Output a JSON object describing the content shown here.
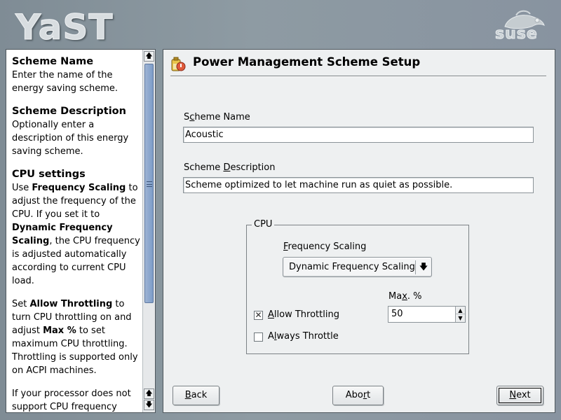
{
  "header": {
    "app_logo_text": "YaST",
    "brand_logo_text": "suse"
  },
  "help": {
    "sections": [
      {
        "heading": "Scheme Name",
        "body": "Enter the name of the energy saving scheme."
      },
      {
        "heading": "Scheme Description",
        "body": "Optionally enter a description of this energy saving scheme."
      },
      {
        "heading": "CPU settings"
      }
    ],
    "cpu_p1": {
      "t1": "Use ",
      "b1": "Frequency Scaling",
      "t2": " to adjust the frequency of the CPU. If you set it to ",
      "b2": "Dynamic Frequency Scaling",
      "t3": ", the CPU frequency is adjusted automatically according to current CPU load."
    },
    "cpu_p2": {
      "t1": "Set ",
      "b1": "Allow Throttling",
      "t2": " to turn CPU throttling on and adjust ",
      "b2": "Max %",
      "t3": " to set maximum CPU throttling. Throttling is supported only on ACPI machines."
    },
    "cpu_p3": "If your processor does not support CPU frequency scaling you may want to let"
  },
  "main": {
    "title": "Power Management Scheme Setup",
    "scheme_name_label": {
      "pre": "S",
      "u": "c",
      "post": "heme Name"
    },
    "scheme_name_value": "Acoustic",
    "scheme_desc_label": {
      "pre": "Scheme ",
      "u": "D",
      "post": "escription"
    },
    "scheme_desc_value": "Scheme optimized to let machine run as quiet as possible.",
    "cpu_group_title": "CPU",
    "freq_label": {
      "pre": "",
      "u": "F",
      "post": "requency Scaling"
    },
    "freq_value": "Dynamic Frequency Scaling",
    "max_label": {
      "pre": "Ma",
      "u": "x",
      "post": ". %"
    },
    "max_value": "50",
    "allow_throttling": {
      "pre": "",
      "u": "A",
      "post": "llow Throttling",
      "checked": true
    },
    "always_throttle": {
      "pre": "A",
      "u": "l",
      "post": "ways Throttle",
      "checked": false
    }
  },
  "buttons": {
    "back": {
      "pre": "",
      "u": "B",
      "post": "ack"
    },
    "abort": {
      "pre": "Abo",
      "u": "r",
      "post": "t"
    },
    "next": {
      "pre": "",
      "u": "N",
      "post": "ext"
    }
  },
  "colors": {
    "background": "#8a969e",
    "panel": "#eef0f1",
    "scroll_thumb": "#8aa6cd"
  },
  "icons": {
    "title": "power-management-icon",
    "combo_arrow": "dropdown-arrow-icon",
    "scroll_up": "scroll-up-icon",
    "scroll_down": "scroll-down-icon"
  }
}
